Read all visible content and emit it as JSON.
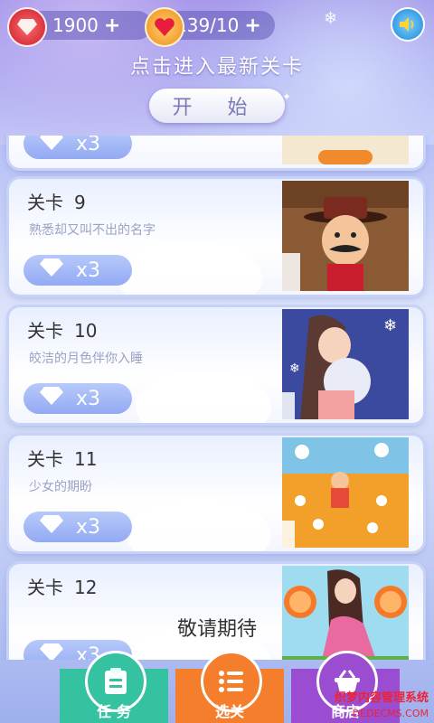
{
  "header": {
    "gems": "1900",
    "hearts": "139/10",
    "plus": "+",
    "hint": "点击进入最新关卡",
    "start_label": "开 始"
  },
  "levels": [
    {
      "label": "关卡",
      "number": "9",
      "desc": "熟悉却又叫不出的名字",
      "reward": "x3"
    },
    {
      "label": "关卡",
      "number": "10",
      "desc": "皎洁的月色伴你入睡",
      "reward": "x3"
    },
    {
      "label": "关卡",
      "number": "11",
      "desc": "少女的期盼",
      "reward": "x3"
    },
    {
      "label": "关卡",
      "number": "12",
      "desc": "",
      "reward": "x3"
    }
  ],
  "partial_card": {
    "reward": "x3"
  },
  "locked_message": "敬请期待",
  "tabs": [
    {
      "label": "任 务",
      "icon": "clipboard-icon",
      "color": "#35c2a0"
    },
    {
      "label": "选关",
      "icon": "list-icon",
      "color": "#f47e2c"
    },
    {
      "label": "商店",
      "icon": "basket-icon",
      "color": "#9a4dd0"
    }
  ],
  "watermark": {
    "line1": "织梦内容管理系统",
    "line2": "DEDECMS.COM"
  },
  "colors": {
    "accent": "#7c78b8",
    "reward_pill": "#93aaf3"
  }
}
